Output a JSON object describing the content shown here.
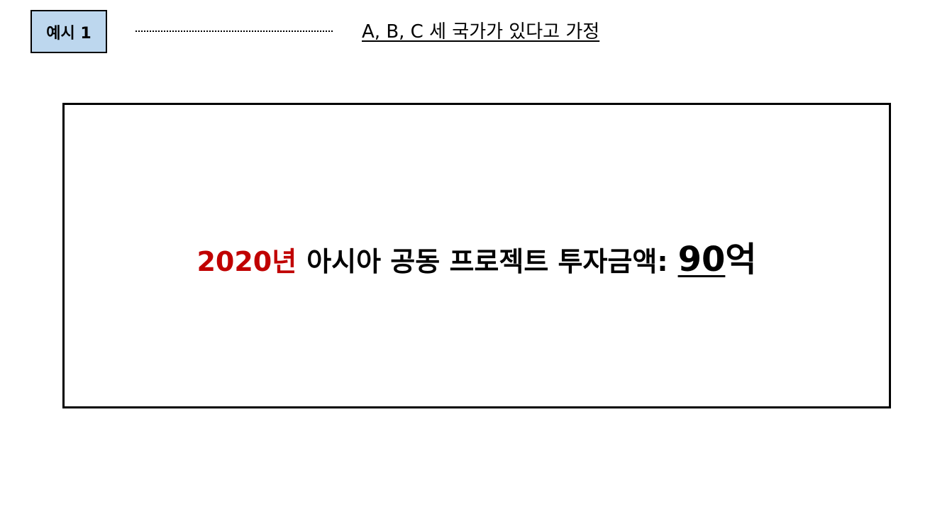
{
  "header": {
    "example_label": "예시 1",
    "assumption_text": "A, B, C 세 국가가 있다고 가정"
  },
  "main": {
    "year": "2020년",
    "label": "아시아 공동 프로젝트 투자금액:",
    "amount": "90",
    "unit": "억"
  },
  "colors": {
    "badge_background": "#bdd7ee",
    "year_color": "#c00000",
    "border": "#000000"
  }
}
